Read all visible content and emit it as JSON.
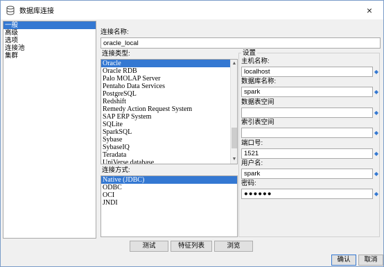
{
  "window": {
    "title": "数据库连接",
    "close_icon": "×"
  },
  "nav": {
    "items": [
      "一般",
      "高级",
      "选项",
      "连接池",
      "集群"
    ],
    "selected": 0
  },
  "connection_name": {
    "label": "连接名称:",
    "value": "oracle_local"
  },
  "connection_type": {
    "label": "连接类型:",
    "items": [
      "Oracle",
      "Oracle RDB",
      "Palo MOLAP Server",
      "Pentaho Data Services",
      "PostgreSQL",
      "Redshift",
      "Remedy Action Request System",
      "SAP ERP System",
      "SQLite",
      "SparkSQL",
      "Sybase",
      "SybaseIQ",
      "Teradata",
      "UniVerse database"
    ],
    "selected": 0
  },
  "access_method": {
    "label": "连接方式:",
    "items": [
      "Native (JDBC)",
      "ODBC",
      "OCI",
      "JNDI"
    ],
    "selected": 0
  },
  "settings": {
    "label": "设置",
    "host": {
      "label": "主机名称:",
      "value": "localhost"
    },
    "database": {
      "label": "数据库名称:",
      "value": "spark"
    },
    "data_tablespace": {
      "label": "数据表空间",
      "value": ""
    },
    "index_tablespace": {
      "label": "索引表空间",
      "value": ""
    },
    "port": {
      "label": "端口号:",
      "value": "1521"
    },
    "username": {
      "label": "用户名:",
      "value": "spark"
    },
    "password": {
      "label": "密码:",
      "value": "●●●●●●"
    },
    "variable_icon": "◆"
  },
  "buttons": {
    "test": "测试",
    "features": "特征列表",
    "explore": "浏览",
    "ok": "确认",
    "cancel": "取消"
  },
  "colors": {
    "selection": "#3478d2"
  }
}
